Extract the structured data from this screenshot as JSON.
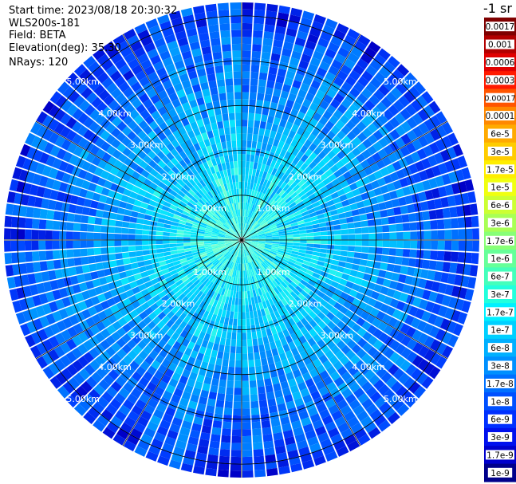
{
  "header": {
    "start_time": "Start time: 2023/08/18 20:30:32",
    "device": "WLS200s-181",
    "field": "Field: BETA",
    "elevation": "Elevation(deg): 35.30",
    "nrays": "NRays: 120"
  },
  "colorbar": {
    "unit_label": "-1 sr",
    "ticks": [
      "0.0017",
      "0.001",
      "0.0006",
      "0.0003",
      "0.00017",
      "0.0001",
      "6e-5",
      "3e-5",
      "1.7e-5",
      "1e-5",
      "6e-6",
      "3e-6",
      "1.7e-6",
      "1e-6",
      "6e-7",
      "3e-7",
      "1.7e-7",
      "1e-7",
      "6e-8",
      "3e-8",
      "1.7e-8",
      "1e-8",
      "6e-9",
      "3e-9",
      "1.7e-9",
      "1e-9"
    ],
    "colors": [
      "#7f0000",
      "#b20000",
      "#e00000",
      "#ff1a00",
      "#ff5500",
      "#ff8800",
      "#ffaa00",
      "#ffcc00",
      "#ffee00",
      "#f0ff10",
      "#ccff33",
      "#a8ff55",
      "#88ff77",
      "#66ff99",
      "#44ffbb",
      "#22ffdd",
      "#00f0ff",
      "#00d0ff",
      "#00b0ff",
      "#0090ff",
      "#0070ff",
      "#0050ff",
      "#0030ff",
      "#0010ee",
      "#0000cc",
      "#00008b"
    ]
  },
  "chart_data": {
    "type": "heatmap",
    "projection": "polar (plan position indicator)",
    "n_rays": 120,
    "max_range_km": 5.3,
    "range_rings_km": [
      1,
      2,
      3,
      4,
      5
    ],
    "ring_labels": [
      "1.00km",
      "2.00km",
      "3.00km",
      "4.00km",
      "5.00km"
    ],
    "value_scale": "log",
    "value_range": [
      1e-09,
      0.0017
    ],
    "typical_values": {
      "near_center": "1e-7",
      "mid_range": "3e-8",
      "far_range": "1e-8"
    },
    "grid": true
  }
}
